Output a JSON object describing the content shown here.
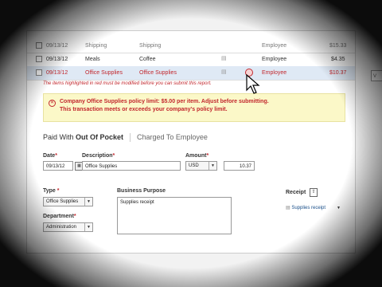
{
  "rows": [
    {
      "date": "09/13/12",
      "category": "Shipping",
      "merchant": "Shipping",
      "paid_by": "Employee",
      "amount": "$15.33",
      "selected": false,
      "dim": true
    },
    {
      "date": "09/13/12",
      "category": "Meals",
      "merchant": "Coffee",
      "paid_by": "Employee",
      "amount": "$4.35",
      "selected": false,
      "dim": false
    },
    {
      "date": "09/13/12",
      "category": "Office Supplies",
      "merchant": "Office Supplies",
      "paid_by": "Employee",
      "amount": "$10.37",
      "selected": true,
      "dim": false
    }
  ],
  "warning_line": "The items highlighted in red must be modified before you can submit this report.",
  "alert": {
    "line1": "Company Office Supplies policy limit: $5.00 per item. Adjust before submitting.",
    "line2": "This transaction meets or exceeds your company's policy limit."
  },
  "tabs": {
    "paid_with_prefix": "Paid With ",
    "paid_with_value": "Out Of Pocket",
    "charged": "Charged To Employee"
  },
  "form": {
    "date_label": "Date",
    "date_value": "09/13/12",
    "description_label": "Description",
    "description_value": "Office Supplies",
    "amount_label": "Amount",
    "currency_value": "USD",
    "amount_value": "10.37",
    "type_label": "Type",
    "type_value": "Office Supplies",
    "department_label": "Department",
    "department_value": "Administration",
    "business_purpose_label": "Business Purpose",
    "business_purpose_value": "Supplies receipt",
    "receipt_label": "Receipt",
    "receipt_value": "Supplies receipt"
  },
  "colors": {
    "error": "#c2272d",
    "alert_bg": "#fbf8c8",
    "selected_row": "#dfe9f5"
  }
}
